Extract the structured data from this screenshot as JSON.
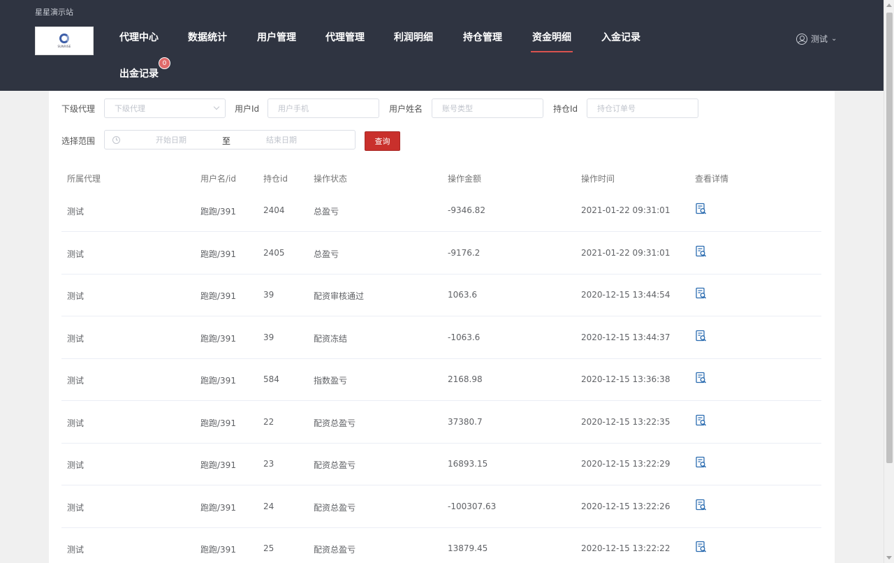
{
  "header": {
    "site_name": "星星演示站",
    "logo_text": "SUNRISE",
    "nav": [
      {
        "label": "代理中心"
      },
      {
        "label": "数据统计"
      },
      {
        "label": "用户管理"
      },
      {
        "label": "代理管理"
      },
      {
        "label": "利润明细"
      },
      {
        "label": "持仓管理"
      },
      {
        "label": "资金明细",
        "active": true
      },
      {
        "label": "入金记录"
      },
      {
        "label": "出金记录",
        "badge": "0"
      }
    ],
    "user": {
      "name": "测试",
      "icon": "user-icon"
    }
  },
  "filters": {
    "agent_label": "下级代理",
    "agent_placeholder": "下级代理",
    "userid_label": "用户Id",
    "userid_placeholder": "用户手机",
    "username_label": "用户姓名",
    "username_placeholder": "账号类型",
    "positionid_label": "持仓Id",
    "positionid_placeholder": "持仓订单号",
    "range_label": "选择范围",
    "start_placeholder": "开始日期",
    "range_sep": "至",
    "end_placeholder": "结束日期",
    "query_label": "查询"
  },
  "table": {
    "columns": [
      "所属代理",
      "用户名/id",
      "持仓id",
      "操作状态",
      "操作金额",
      "操作时间",
      "查看详情"
    ],
    "detail_icon": "view-detail-icon",
    "rows": [
      {
        "agent": "测试",
        "user": "跑跑/391",
        "pos": "2404",
        "status": "总盈亏",
        "amount": "-9346.82",
        "time": "2021-01-22 09:31:01"
      },
      {
        "agent": "测试",
        "user": "跑跑/391",
        "pos": "2405",
        "status": "总盈亏",
        "amount": "-9176.2",
        "time": "2021-01-22 09:31:01"
      },
      {
        "agent": "测试",
        "user": "跑跑/391",
        "pos": "39",
        "status": "配资审核通过",
        "amount": "1063.6",
        "time": "2020-12-15 13:44:54"
      },
      {
        "agent": "测试",
        "user": "跑跑/391",
        "pos": "39",
        "status": "配资冻结",
        "amount": "-1063.6",
        "time": "2020-12-15 13:44:37"
      },
      {
        "agent": "测试",
        "user": "跑跑/391",
        "pos": "584",
        "status": "指数盈亏",
        "amount": "2168.98",
        "time": "2020-12-15 13:36:38"
      },
      {
        "agent": "测试",
        "user": "跑跑/391",
        "pos": "22",
        "status": "配资总盈亏",
        "amount": "37380.7",
        "time": "2020-12-15 13:22:35"
      },
      {
        "agent": "测试",
        "user": "跑跑/391",
        "pos": "23",
        "status": "配资总盈亏",
        "amount": "16893.15",
        "time": "2020-12-15 13:22:29"
      },
      {
        "agent": "测试",
        "user": "跑跑/391",
        "pos": "24",
        "status": "配资总盈亏",
        "amount": "-100307.63",
        "time": "2020-12-15 13:22:26"
      },
      {
        "agent": "测试",
        "user": "跑跑/391",
        "pos": "25",
        "status": "配资总盈亏",
        "amount": "13879.45",
        "time": "2020-12-15 13:22:22"
      }
    ]
  }
}
